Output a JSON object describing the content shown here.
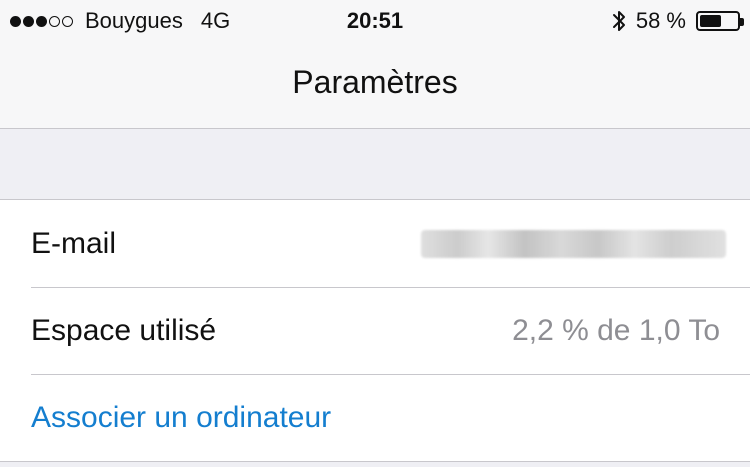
{
  "status_bar": {
    "carrier": "Bouygues",
    "network": "4G",
    "time": "20:51",
    "battery_percent_text": "58 %",
    "battery_level": 0.58,
    "signal_bars_filled": 3,
    "signal_bars_total": 5
  },
  "nav": {
    "title": "Paramètres"
  },
  "settings": {
    "rows": [
      {
        "label": "E-mail",
        "value": ""
      },
      {
        "label": "Espace utilisé",
        "value": "2,2 % de 1,0  To"
      },
      {
        "label": "Associer un ordinateur"
      }
    ]
  },
  "colors": {
    "link": "#147ecf",
    "secondary_text": "#8e8e93",
    "background": "#efeff4",
    "bar": "#f7f7f8"
  },
  "icons": {
    "bluetooth": "bluetooth-icon",
    "battery": "battery-icon",
    "signal": "signal-dots-icon"
  }
}
